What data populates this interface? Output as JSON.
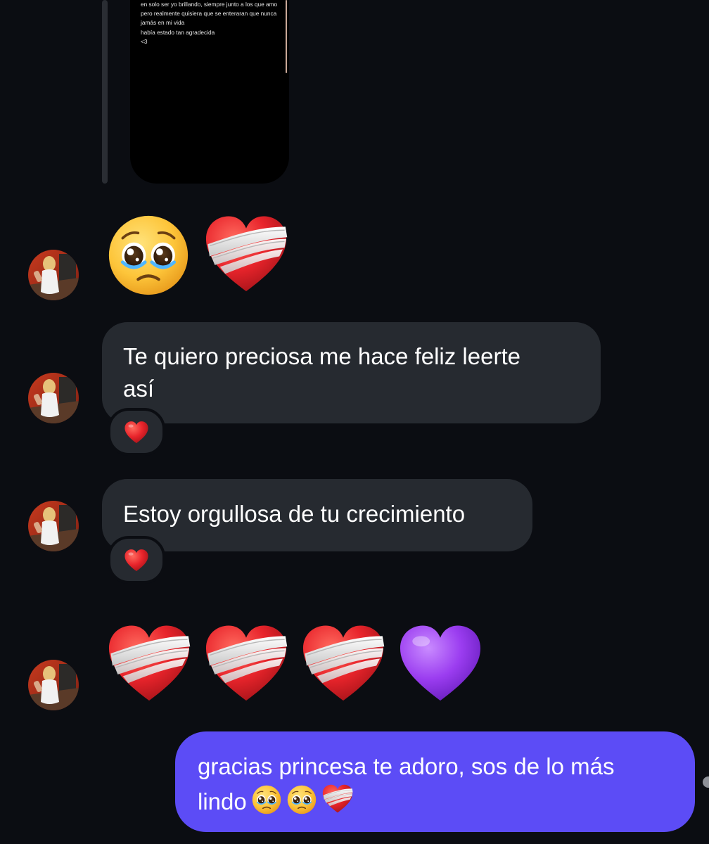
{
  "colors": {
    "background": "#0b0d12",
    "received_bubble": "#262a30",
    "sent_bubble": "#5c4cf6",
    "text": "#ffffff",
    "heart_red": "#e8242b",
    "heart_purple": "#9b3df0"
  },
  "story_reply": {
    "lines": [
      "en solo ser yo brillando, siempre junto a los que amo",
      "pero realmente quisiera que se enteraran que nunca",
      "jamás en mi vida",
      "había estado tan agradecida",
      "<3"
    ]
  },
  "messages": [
    {
      "type": "emoji",
      "sender": "them",
      "icons": [
        "pleading-face-icon",
        "mending-heart-icon"
      ]
    },
    {
      "type": "text",
      "sender": "them",
      "lines": [
        "Te quiero preciosa me hace feliz leerte",
        "así"
      ],
      "reaction_icon": "red-heart-icon"
    },
    {
      "type": "text",
      "sender": "them",
      "lines": [
        "Estoy orgullosa de tu crecimiento"
      ],
      "reaction_icon": "red-heart-icon"
    },
    {
      "type": "emoji",
      "sender": "them",
      "icons": [
        "mending-heart-icon",
        "mending-heart-icon",
        "mending-heart-icon",
        "purple-heart-icon"
      ]
    },
    {
      "type": "text",
      "sender": "me",
      "lines": [
        "gracias princesa te adoro, sos de lo más",
        "lindo"
      ],
      "trailing_icons": [
        "pleading-face-icon",
        "pleading-face-icon",
        "mending-heart-icon"
      ]
    }
  ]
}
